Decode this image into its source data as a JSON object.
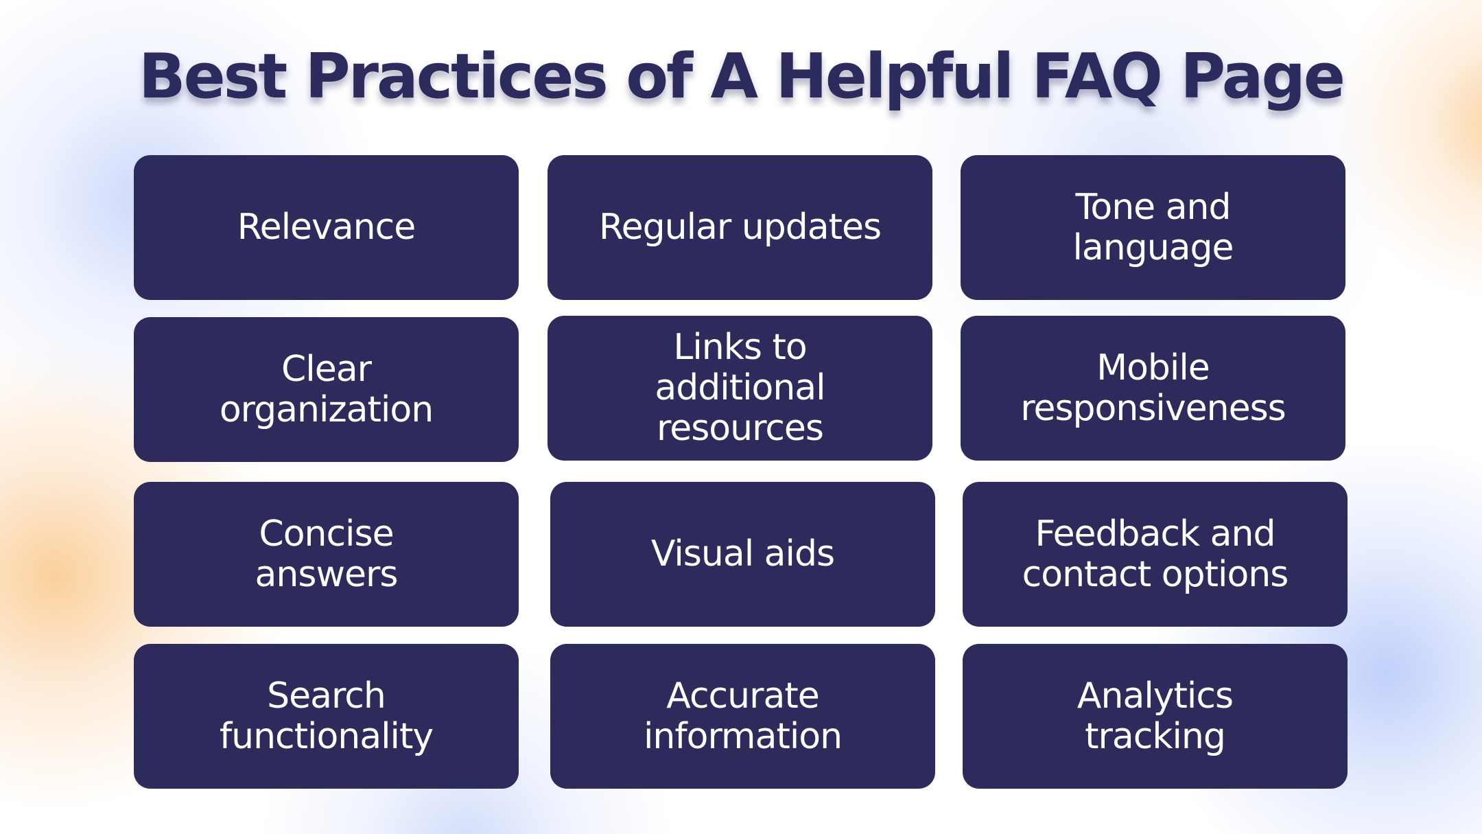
{
  "title": "Best Practices of A Helpful FAQ Page",
  "colors": {
    "title": "#2c2b5d",
    "card_background": "#2c2b5c",
    "card_text": "#ffffff",
    "accent_blue": "#c4d2fa",
    "accent_orange": "#facea0"
  },
  "practices": [
    {
      "label": "Relevance"
    },
    {
      "label": "Regular updates"
    },
    {
      "label": "Tone and language"
    },
    {
      "label": "Clear organization"
    },
    {
      "label": "Links to additional resources"
    },
    {
      "label": "Mobile responsiveness"
    },
    {
      "label": "Concise answers"
    },
    {
      "label": "Visual aids"
    },
    {
      "label": "Feedback and contact options"
    },
    {
      "label": "Search functionality"
    },
    {
      "label": "Accurate information"
    },
    {
      "label": "Analytics tracking"
    }
  ]
}
